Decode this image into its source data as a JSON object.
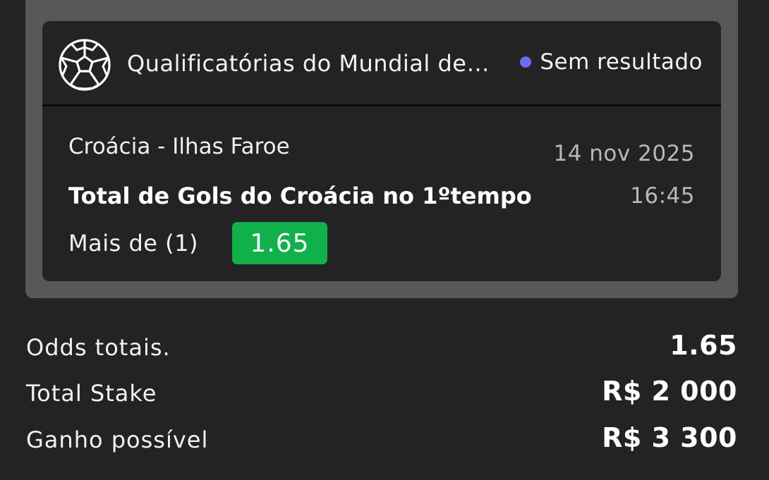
{
  "bet": {
    "sport_icon": "soccer-ball-icon",
    "competition": "Qualificatórias do Mundial de…",
    "status": {
      "label": "Sem resultado",
      "dot_color": "#6b6bf5"
    },
    "match": "Croácia - Ilhas Faroe",
    "date": "14 nov 2025",
    "time": "16:45",
    "market": "Total de Gols do Croácia no 1ºtempo",
    "selection": "Mais de (1)",
    "odd": "1.65",
    "odd_color": "#10b04a"
  },
  "summary": {
    "total_odds_label": "Odds totais.",
    "total_odds_value": "1.65",
    "stake_label": "Total Stake",
    "stake_value": "R$ 2 000",
    "potential_win_label": "Ganho possível",
    "potential_win_value": "R$ 3 300"
  }
}
